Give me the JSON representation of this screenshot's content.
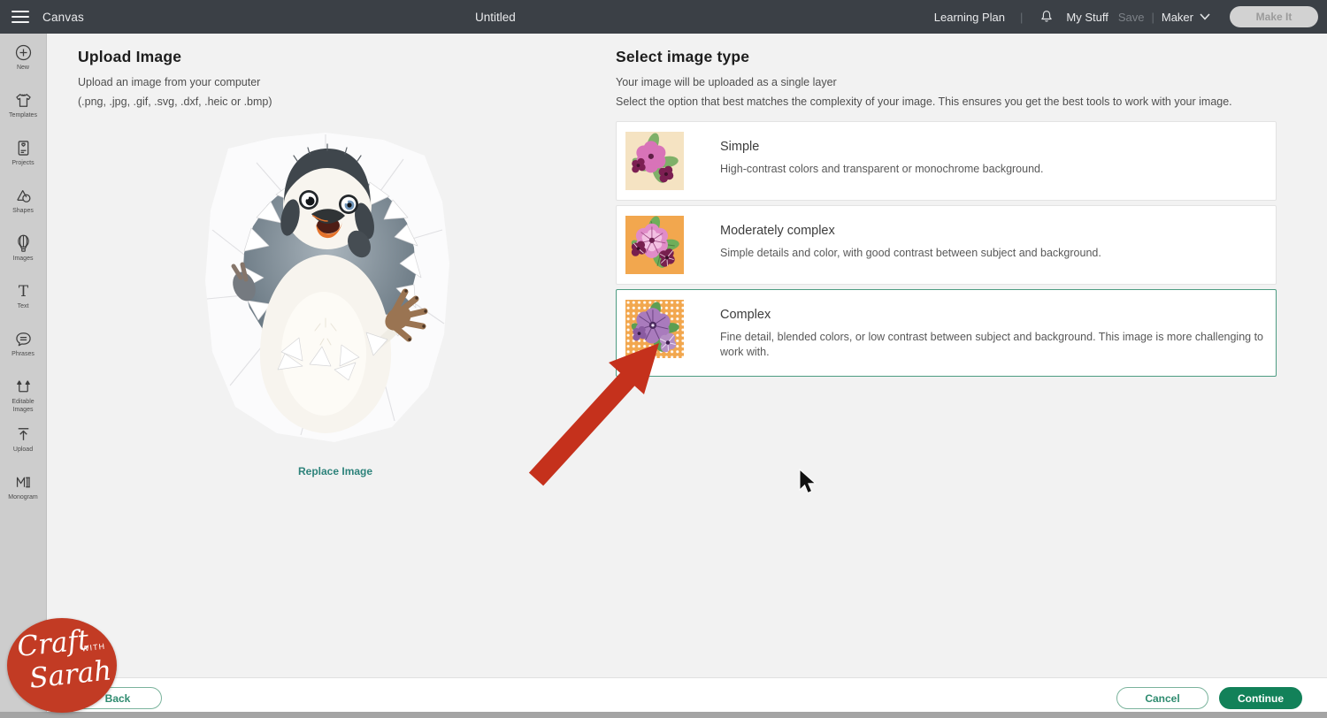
{
  "topbar": {
    "canvas_label": "Canvas",
    "document_title": "Untitled",
    "learning_plan_label": "Learning Plan",
    "divider": "|",
    "my_stuff_label": "My Stuff",
    "save_label": "Save",
    "machine_label": "Maker",
    "make_it_label": "Make It",
    "icons": {
      "menu": "hamburger-icon",
      "notifications": "bell-icon",
      "machine_dropdown": "chevron-down-icon"
    }
  },
  "sidebar": {
    "items": [
      {
        "label": "New",
        "icon": "plus-circle-icon"
      },
      {
        "label": "Templates",
        "icon": "tshirt-icon"
      },
      {
        "label": "Projects",
        "icon": "project-card-icon"
      },
      {
        "label": "Shapes",
        "icon": "shapes-icon"
      },
      {
        "label": "Images",
        "icon": "hot-air-balloon-icon"
      },
      {
        "label": "Text",
        "icon": "letter-t-icon"
      },
      {
        "label": "Phrases",
        "icon": "speech-bubble-icon"
      },
      {
        "label": "Editable Images",
        "icon": "editable-images-icon"
      },
      {
        "label": "Upload",
        "icon": "upload-arrow-icon"
      },
      {
        "label": "Monogram",
        "icon": "monogram-icon"
      }
    ]
  },
  "upload_panel": {
    "title": "Upload Image",
    "subtitle": "Upload an image from your computer",
    "formats": "(.png, .jpg, .gif, .svg, .dxf, .heic or .bmp)",
    "replace_label": "Replace Image"
  },
  "select_panel": {
    "title": "Select image type",
    "subtitle": "Your image will be uploaded as a single layer",
    "hint": "Select the option that best matches the complexity of your image. This ensures you get the best tools to work with your image.",
    "options": [
      {
        "name": "Simple",
        "description": "High-contrast colors and transparent or monochrome background.",
        "selected": false,
        "thumb_icon": "simple-flowers-thumbnail"
      },
      {
        "name": "Moderately complex",
        "description": "Simple details and color, with good contrast between subject and background.",
        "selected": false,
        "thumb_icon": "moderately-complex-flowers-thumbnail"
      },
      {
        "name": "Complex",
        "description": "Fine detail, blended colors, or low contrast between subject and background. This image is more challenging to work with.",
        "selected": true,
        "thumb_icon": "complex-flowers-thumbnail"
      }
    ]
  },
  "footer": {
    "back_label": "Back",
    "cancel_label": "Cancel",
    "continue_label": "Continue"
  },
  "watermark": {
    "line1": "Craft",
    "line2": "with",
    "line3": "Sarah"
  },
  "colors": {
    "topbar_bg": "#3b4046",
    "sidebar_bg": "#cdcdcd",
    "page_bg": "#f2f2f2",
    "accent_teal": "#2e837b",
    "selected_border": "#4d9c82",
    "continue_green": "#128159",
    "arrow_red": "#c5311c",
    "logo_red": "#c23b24"
  }
}
